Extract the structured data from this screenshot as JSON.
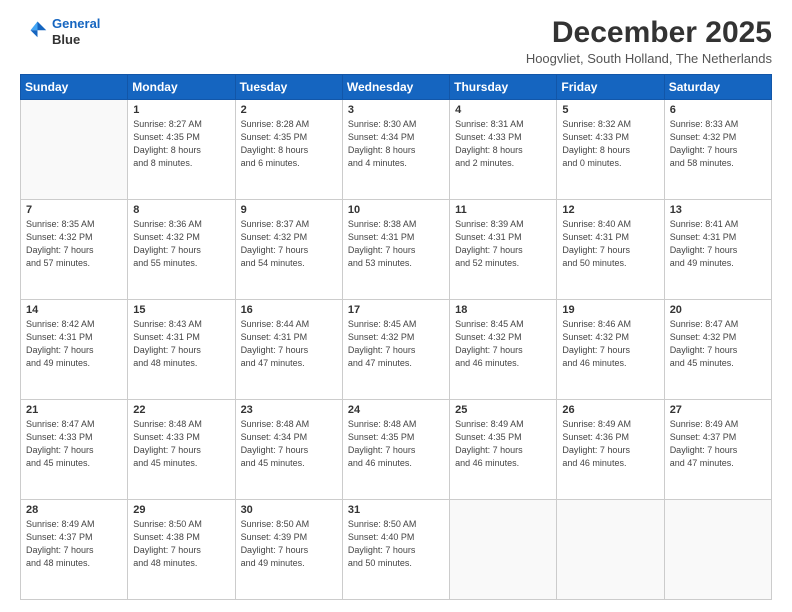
{
  "logo": {
    "line1": "General",
    "line2": "Blue"
  },
  "header": {
    "month": "December 2025",
    "location": "Hoogvliet, South Holland, The Netherlands"
  },
  "weekdays": [
    "Sunday",
    "Monday",
    "Tuesday",
    "Wednesday",
    "Thursday",
    "Friday",
    "Saturday"
  ],
  "weeks": [
    [
      {
        "day": "",
        "info": ""
      },
      {
        "day": "1",
        "info": "Sunrise: 8:27 AM\nSunset: 4:35 PM\nDaylight: 8 hours\nand 8 minutes."
      },
      {
        "day": "2",
        "info": "Sunrise: 8:28 AM\nSunset: 4:35 PM\nDaylight: 8 hours\nand 6 minutes."
      },
      {
        "day": "3",
        "info": "Sunrise: 8:30 AM\nSunset: 4:34 PM\nDaylight: 8 hours\nand 4 minutes."
      },
      {
        "day": "4",
        "info": "Sunrise: 8:31 AM\nSunset: 4:33 PM\nDaylight: 8 hours\nand 2 minutes."
      },
      {
        "day": "5",
        "info": "Sunrise: 8:32 AM\nSunset: 4:33 PM\nDaylight: 8 hours\nand 0 minutes."
      },
      {
        "day": "6",
        "info": "Sunrise: 8:33 AM\nSunset: 4:32 PM\nDaylight: 7 hours\nand 58 minutes."
      }
    ],
    [
      {
        "day": "7",
        "info": "Sunrise: 8:35 AM\nSunset: 4:32 PM\nDaylight: 7 hours\nand 57 minutes."
      },
      {
        "day": "8",
        "info": "Sunrise: 8:36 AM\nSunset: 4:32 PM\nDaylight: 7 hours\nand 55 minutes."
      },
      {
        "day": "9",
        "info": "Sunrise: 8:37 AM\nSunset: 4:32 PM\nDaylight: 7 hours\nand 54 minutes."
      },
      {
        "day": "10",
        "info": "Sunrise: 8:38 AM\nSunset: 4:31 PM\nDaylight: 7 hours\nand 53 minutes."
      },
      {
        "day": "11",
        "info": "Sunrise: 8:39 AM\nSunset: 4:31 PM\nDaylight: 7 hours\nand 52 minutes."
      },
      {
        "day": "12",
        "info": "Sunrise: 8:40 AM\nSunset: 4:31 PM\nDaylight: 7 hours\nand 50 minutes."
      },
      {
        "day": "13",
        "info": "Sunrise: 8:41 AM\nSunset: 4:31 PM\nDaylight: 7 hours\nand 49 minutes."
      }
    ],
    [
      {
        "day": "14",
        "info": "Sunrise: 8:42 AM\nSunset: 4:31 PM\nDaylight: 7 hours\nand 49 minutes."
      },
      {
        "day": "15",
        "info": "Sunrise: 8:43 AM\nSunset: 4:31 PM\nDaylight: 7 hours\nand 48 minutes."
      },
      {
        "day": "16",
        "info": "Sunrise: 8:44 AM\nSunset: 4:31 PM\nDaylight: 7 hours\nand 47 minutes."
      },
      {
        "day": "17",
        "info": "Sunrise: 8:45 AM\nSunset: 4:32 PM\nDaylight: 7 hours\nand 47 minutes."
      },
      {
        "day": "18",
        "info": "Sunrise: 8:45 AM\nSunset: 4:32 PM\nDaylight: 7 hours\nand 46 minutes."
      },
      {
        "day": "19",
        "info": "Sunrise: 8:46 AM\nSunset: 4:32 PM\nDaylight: 7 hours\nand 46 minutes."
      },
      {
        "day": "20",
        "info": "Sunrise: 8:47 AM\nSunset: 4:32 PM\nDaylight: 7 hours\nand 45 minutes."
      }
    ],
    [
      {
        "day": "21",
        "info": "Sunrise: 8:47 AM\nSunset: 4:33 PM\nDaylight: 7 hours\nand 45 minutes."
      },
      {
        "day": "22",
        "info": "Sunrise: 8:48 AM\nSunset: 4:33 PM\nDaylight: 7 hours\nand 45 minutes."
      },
      {
        "day": "23",
        "info": "Sunrise: 8:48 AM\nSunset: 4:34 PM\nDaylight: 7 hours\nand 45 minutes."
      },
      {
        "day": "24",
        "info": "Sunrise: 8:48 AM\nSunset: 4:35 PM\nDaylight: 7 hours\nand 46 minutes."
      },
      {
        "day": "25",
        "info": "Sunrise: 8:49 AM\nSunset: 4:35 PM\nDaylight: 7 hours\nand 46 minutes."
      },
      {
        "day": "26",
        "info": "Sunrise: 8:49 AM\nSunset: 4:36 PM\nDaylight: 7 hours\nand 46 minutes."
      },
      {
        "day": "27",
        "info": "Sunrise: 8:49 AM\nSunset: 4:37 PM\nDaylight: 7 hours\nand 47 minutes."
      }
    ],
    [
      {
        "day": "28",
        "info": "Sunrise: 8:49 AM\nSunset: 4:37 PM\nDaylight: 7 hours\nand 48 minutes."
      },
      {
        "day": "29",
        "info": "Sunrise: 8:50 AM\nSunset: 4:38 PM\nDaylight: 7 hours\nand 48 minutes."
      },
      {
        "day": "30",
        "info": "Sunrise: 8:50 AM\nSunset: 4:39 PM\nDaylight: 7 hours\nand 49 minutes."
      },
      {
        "day": "31",
        "info": "Sunrise: 8:50 AM\nSunset: 4:40 PM\nDaylight: 7 hours\nand 50 minutes."
      },
      {
        "day": "",
        "info": ""
      },
      {
        "day": "",
        "info": ""
      },
      {
        "day": "",
        "info": ""
      }
    ]
  ]
}
